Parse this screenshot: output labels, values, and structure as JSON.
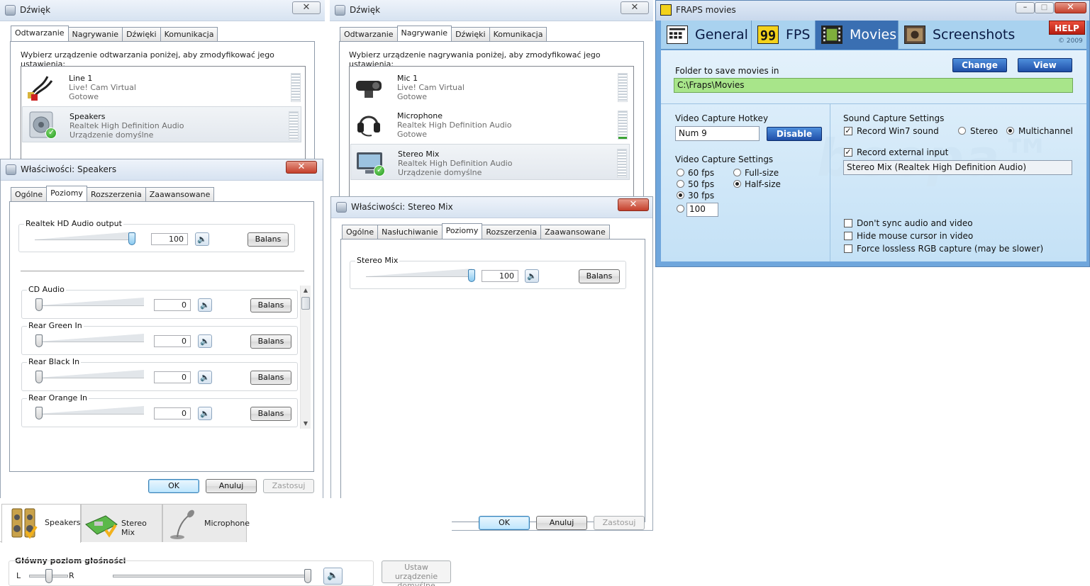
{
  "playback_window": {
    "title": "Dźwięk",
    "tabs": [
      "Odtwarzanie",
      "Nagrywanie",
      "Dźwięki",
      "Komunikacja"
    ],
    "active_tab": "Odtwarzanie",
    "instruction": "Wybierz urządzenie odtwarzania poniżej, aby zmodyfikować jego ustawienia:",
    "devices": [
      {
        "name": "Line 1",
        "driver": "Live! Cam Virtual",
        "status": "Gotowe"
      },
      {
        "name": "Speakers",
        "driver": "Realtek High Definition Audio",
        "status": "Urządzenie domyślne"
      }
    ]
  },
  "recording_window": {
    "title": "Dźwięk",
    "tabs": [
      "Odtwarzanie",
      "Nagrywanie",
      "Dźwięki",
      "Komunikacja"
    ],
    "active_tab": "Nagrywanie",
    "instruction": "Wybierz urządzenie nagrywania poniżej, aby zmodyfikować jego ustawienia:",
    "devices": [
      {
        "name": "Mic 1",
        "driver": "Live! Cam Virtual",
        "status": "Gotowe"
      },
      {
        "name": "Microphone",
        "driver": "Realtek High Definition Audio",
        "status": "Gotowe"
      },
      {
        "name": "Stereo Mix",
        "driver": "Realtek High Definition Audio",
        "status": "Urządzenie domyślne"
      }
    ]
  },
  "speakers_props": {
    "title": "Właściwości: Speakers",
    "tabs": [
      "Ogólne",
      "Poziomy",
      "Rozszerzenia",
      "Zaawansowane"
    ],
    "active_tab": "Poziomy",
    "main": {
      "label": "Realtek HD Audio output",
      "value": "100",
      "level": 1.0,
      "balance_label": "Balans"
    },
    "channels": [
      {
        "label": "CD Audio",
        "value": "0",
        "level": 0.0,
        "balance_label": "Balans"
      },
      {
        "label": "Rear Green In",
        "value": "0",
        "level": 0.0,
        "balance_label": "Balans"
      },
      {
        "label": "Rear Black In",
        "value": "0",
        "level": 0.0,
        "balance_label": "Balans"
      },
      {
        "label": "Rear Orange In",
        "value": "0",
        "level": 0.0,
        "balance_label": "Balans"
      }
    ],
    "buttons": {
      "ok": "OK",
      "cancel": "Anuluj",
      "apply": "Zastosuj"
    }
  },
  "stereomix_props": {
    "title": "Właściwości: Stereo Mix",
    "tabs": [
      "Ogólne",
      "Nasłuchiwanie",
      "Poziomy",
      "Rozszerzenia",
      "Zaawansowane"
    ],
    "active_tab": "Poziomy",
    "main": {
      "label": "Stereo Mix",
      "value": "100",
      "level": 1.0,
      "balance_label": "Balans"
    },
    "buttons": {
      "ok": "OK",
      "cancel": "Anuluj",
      "apply": "Zastosuj"
    }
  },
  "device_bar": {
    "tabs": [
      {
        "label": "Speakers",
        "icon": "speakers-icon"
      },
      {
        "label": "Stereo Mix",
        "icon": "stereo-mix-icon"
      },
      {
        "label": "Microphone",
        "icon": "microphone-icon"
      }
    ],
    "master_label": "Główny poziom głośności",
    "left": "L",
    "right": "R",
    "balance_level": 0.5,
    "volume_level": 1.0,
    "set_default": "Ustaw urządzenie domyślne"
  },
  "fraps": {
    "title": "FRAPS movies",
    "tabs": [
      {
        "label": "General",
        "icon": "general-icon"
      },
      {
        "label": "FPS",
        "icon": "fps-icon"
      },
      {
        "label": "Movies",
        "icon": "movies-icon"
      },
      {
        "label": "Screenshots",
        "icon": "screenshots-icon"
      }
    ],
    "active_tab": "Movies",
    "help": "HELP",
    "copyright": "© 2009",
    "watermark": "beepa™",
    "folder_label": "Folder to save movies in",
    "change": "Change",
    "view": "View",
    "folder_path": "C:\\Fraps\\Movies",
    "hotkey_label": "Video Capture Hotkey",
    "hotkey_value": "Num 9",
    "disable": "Disable",
    "video_settings_label": "Video Capture Settings",
    "fps_options": [
      "60 fps",
      "50 fps",
      "30 fps"
    ],
    "fps_selected": "30 fps",
    "custom_fps": "100",
    "size_options": [
      "Full-size",
      "Half-size"
    ],
    "size_selected": "Half-size",
    "sound_label": "Sound Capture Settings",
    "record_win7": "Record Win7 sound",
    "stereo": "Stereo",
    "multichannel": "Multichannel",
    "channel_selected": "Multichannel",
    "record_external": "Record external input",
    "external_device": "Stereo Mix (Realtek High Definition Audio)",
    "options": [
      {
        "label": "Don't sync audio and video",
        "checked": false
      },
      {
        "label": "Hide mouse cursor in video",
        "checked": false
      },
      {
        "label": "Force lossless RGB capture (may be slower)",
        "checked": false
      }
    ]
  },
  "colors": {
    "accent_blue": "#3a6fb2",
    "fraps_path_bg": "#a8e58a",
    "fraps_bg": "#6fa6dc",
    "win_title": "#d7e3f1"
  }
}
